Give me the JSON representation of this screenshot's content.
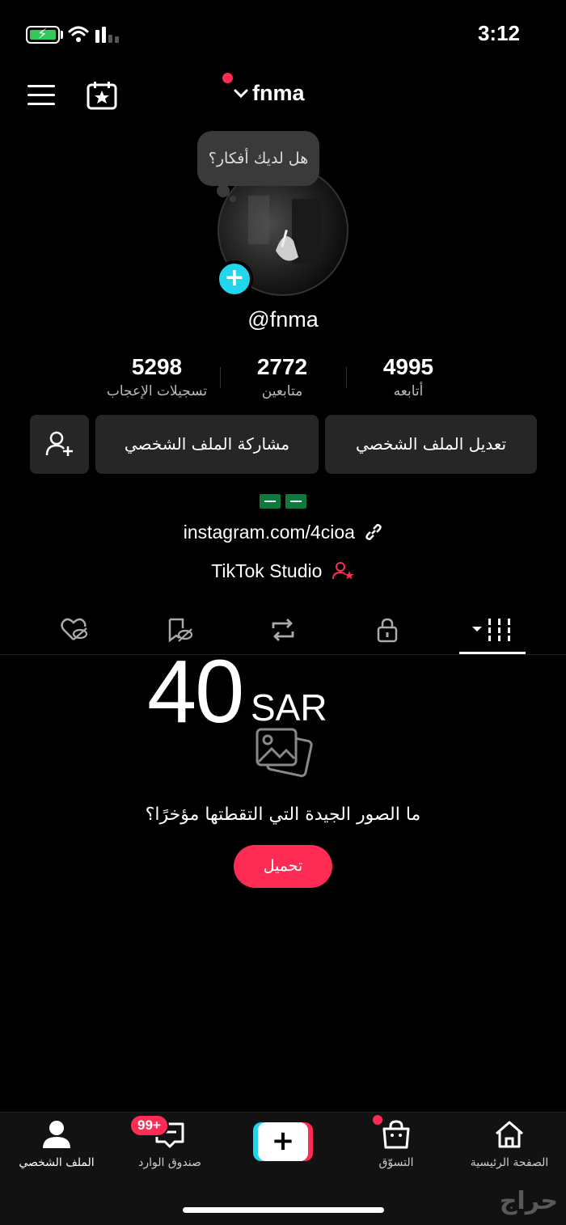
{
  "status_bar": {
    "time": "3:12"
  },
  "header": {
    "username": "fnma"
  },
  "profile": {
    "bubble_text": "هل لديك أفكار؟",
    "handle": "@fnma",
    "stats": [
      {
        "value": "4995",
        "label": "أتابعه"
      },
      {
        "value": "2772",
        "label": "متابعين"
      },
      {
        "value": "5298",
        "label": "تسجيلات الإعجاب"
      }
    ],
    "buttons": {
      "edit": "تعديل الملف الشخصي",
      "share": "مشاركة الملف الشخصي"
    },
    "bio_flags": "🇸🇦 🇸🇦",
    "link": "instagram.com/4cioa",
    "studio": "TikTok Studio"
  },
  "tabs": {
    "items": [
      "videos-grid-icon",
      "lock-icon",
      "repost-icon",
      "saved-hidden-icon",
      "liked-hidden-icon"
    ],
    "active_index": 0
  },
  "empty_state": {
    "price_number": "40",
    "price_currency": "SAR",
    "text": "ما الصور الجيدة التي التقطتها مؤخرًا؟",
    "button": "تحميل"
  },
  "bottom_nav": {
    "home": "الصفحة الرئيسية",
    "shop": "التسوّق",
    "inbox": "صندوق الوارد",
    "inbox_badge": "99+",
    "profile": "الملف الشخصي"
  },
  "watermark": "حراج",
  "colors": {
    "accent": "#fe2c55",
    "cyan": "#20d5ec",
    "button_bg": "#262626"
  }
}
